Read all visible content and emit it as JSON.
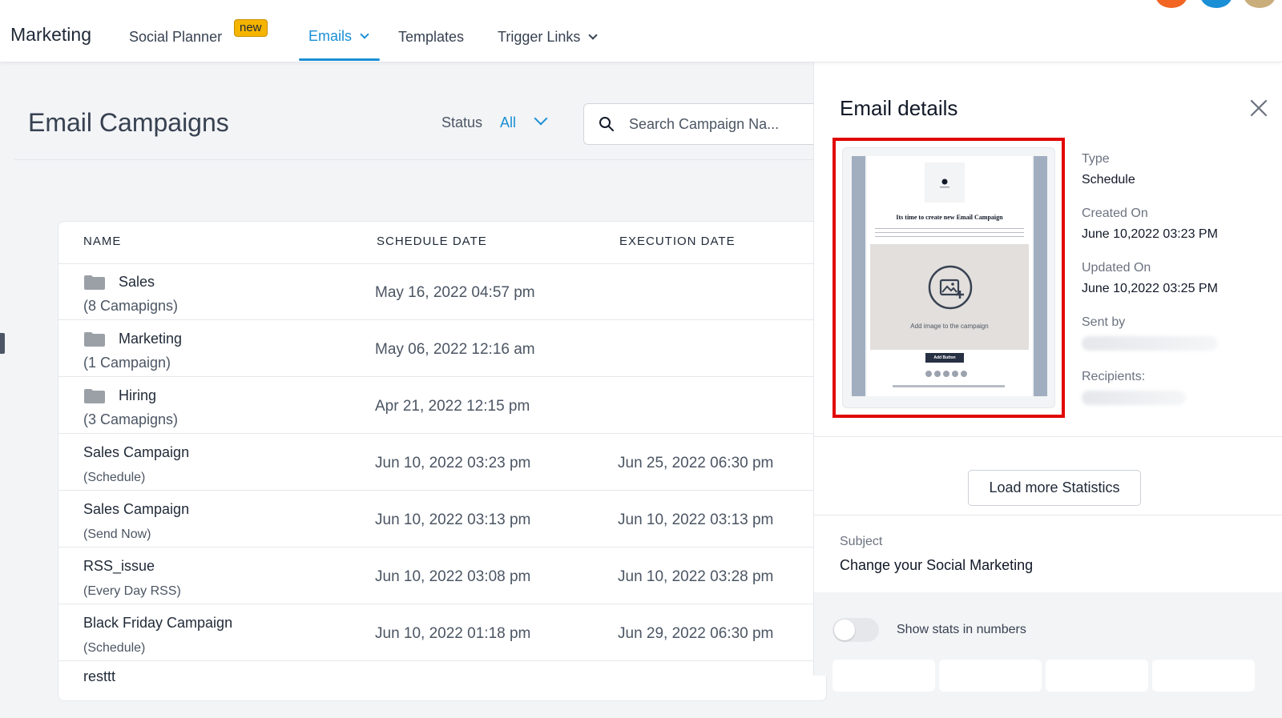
{
  "nav": {
    "brand": "Marketing",
    "items": [
      {
        "label": "Social Planner",
        "badge": "new"
      },
      {
        "label": "Emails",
        "active": true
      },
      {
        "label": "Templates"
      },
      {
        "label": "Trigger Links"
      }
    ],
    "accent_color": "#1a8fd6",
    "badge_color": "#f5b400",
    "avatar_colors": [
      "#f26522",
      "#1a8fd6",
      "#c9ad7b"
    ]
  },
  "main": {
    "title": "Email Campaigns",
    "status_label": "Status",
    "status_value": "All",
    "search_placeholder": "Search Campaign Na...",
    "columns": [
      "NAME",
      "SCHEDULE DATE",
      "EXECUTION DATE"
    ],
    "rows": [
      {
        "type": "folder",
        "name": "Sales",
        "sub": "(8 Camapigns)",
        "schedule": "May 16, 2022 04:57 pm",
        "execution": ""
      },
      {
        "type": "folder",
        "name": "Marketing",
        "sub": "(1 Campaign)",
        "schedule": "May 06, 2022 12:16 am",
        "execution": ""
      },
      {
        "type": "folder",
        "name": "Hiring",
        "sub": "(3 Camapigns)",
        "schedule": "Apr 21, 2022 12:15 pm",
        "execution": ""
      },
      {
        "type": "campaign",
        "name": "Sales Campaign",
        "sub": "(Schedule)",
        "schedule": "Jun 10, 2022 03:23 pm",
        "execution": "Jun 25, 2022 06:30 pm"
      },
      {
        "type": "campaign",
        "name": "Sales Campaign",
        "sub": "(Send Now)",
        "schedule": "Jun 10, 2022 03:13 pm",
        "execution": "Jun 10, 2022 03:13 pm"
      },
      {
        "type": "campaign",
        "name": "RSS_issue",
        "sub": "(Every Day RSS)",
        "schedule": "Jun 10, 2022 03:08 pm",
        "execution": "Jun 10, 2022 03:28 pm"
      },
      {
        "type": "campaign",
        "name": "Black Friday Campaign",
        "sub": "(Schedule)",
        "schedule": "Jun 10, 2022 01:18 pm",
        "execution": "Jun 29, 2022 06:30 pm"
      },
      {
        "type": "campaign",
        "name": "resttt",
        "sub": "",
        "schedule": "",
        "execution": ""
      }
    ]
  },
  "panel": {
    "title": "Email details",
    "preview": {
      "heading": "Its time to create new Email Campaign",
      "image_caption": "Add image to the campaign",
      "button_label": "Add Button",
      "frame_color": "#e10600"
    },
    "type_label": "Type",
    "type_value": "Schedule",
    "created_label": "Created On",
    "created_value": "June 10,2022 03:23 PM",
    "updated_label": "Updated On",
    "updated_value": "June 10,2022 03:25 PM",
    "sent_by_label": "Sent by",
    "recipients_label": "Recipients:",
    "load_more_label": "Load more Statistics",
    "subject_label": "Subject",
    "subject_value": "Change your Social Marketing",
    "toggle_label": "Show stats in numbers"
  }
}
